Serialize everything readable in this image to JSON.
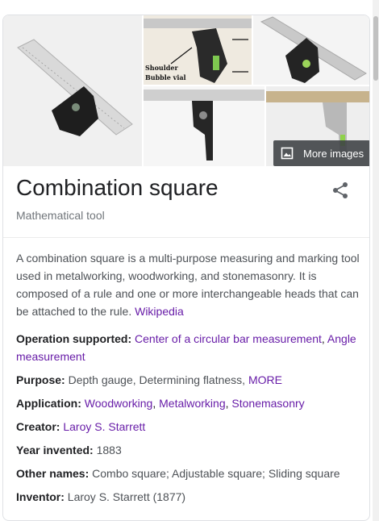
{
  "images": {
    "main_alt": "combination-square-photo",
    "photo2_labels": [
      "Shoulder",
      "Bubble vial"
    ],
    "more_images_label": "More images"
  },
  "header": {
    "title": "Combination square",
    "subtitle": "Mathematical tool"
  },
  "description": {
    "text": "A combination square is a multi-purpose measuring and marking tool used in metalworking, woodworking, and stonemasonry. It is composed of a rule and one or more interchangeable heads that can be attached to the rule.",
    "source_link": "Wikipedia"
  },
  "facts": {
    "operation": {
      "label": "Operation supported:",
      "links": [
        "Center of a circular bar measurement",
        "Angle measurement"
      ]
    },
    "purpose": {
      "label": "Purpose:",
      "text": "Depth gauge, Determining flatness,",
      "more": "MORE"
    },
    "application": {
      "label": "Application:",
      "links": [
        "Woodworking",
        "Metalworking",
        "Stonemasonry"
      ]
    },
    "creator": {
      "label": "Creator:",
      "link": "Laroy S. Starrett"
    },
    "year": {
      "label": "Year invented:",
      "text": "1883"
    },
    "other_names": {
      "label": "Other names:",
      "text": "Combo square; Adjustable square; Sliding square"
    },
    "inventor": {
      "label": "Inventor:",
      "text": "Laroy S. Starrett (1877)"
    }
  },
  "colors": {
    "link": "#681da8",
    "text": "#202124",
    "muted": "#4d5156",
    "subtitle": "#70757a"
  }
}
